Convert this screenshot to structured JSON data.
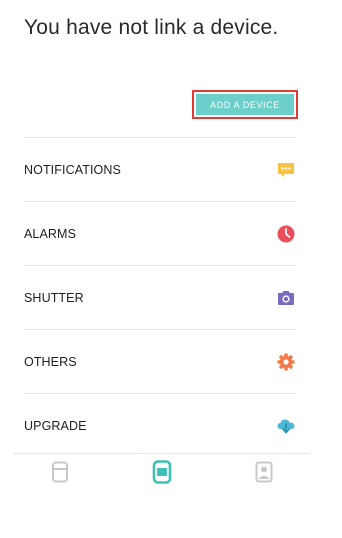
{
  "header": {
    "title": "You have not link a device."
  },
  "actions": {
    "add_device_label": "ADD A DEVICE"
  },
  "menu": {
    "items": [
      {
        "label": "NOTIFICATIONS",
        "icon": "chat-bubble-icon",
        "color": "#f6c244"
      },
      {
        "label": "ALARMS",
        "icon": "clock-icon",
        "color": "#ea4e5b"
      },
      {
        "label": "SHUTTER",
        "icon": "camera-icon",
        "color": "#7a6bbf"
      },
      {
        "label": "OTHERS",
        "icon": "gear-icon",
        "color": "#f27a4a"
      },
      {
        "label": "UPGRADE",
        "icon": "cloud-download-icon",
        "color": "#4ab8d6"
      }
    ]
  },
  "tabbar": {
    "tabs": [
      {
        "icon": "watch-face-icon",
        "active": false
      },
      {
        "icon": "device-icon",
        "active": true
      },
      {
        "icon": "profile-icon",
        "active": false
      }
    ]
  },
  "colors": {
    "accent": "#6ccfc9",
    "highlight_border": "#e23b35",
    "inactive_tab": "#c8c8c8",
    "active_tab": "#3dc0b5"
  }
}
